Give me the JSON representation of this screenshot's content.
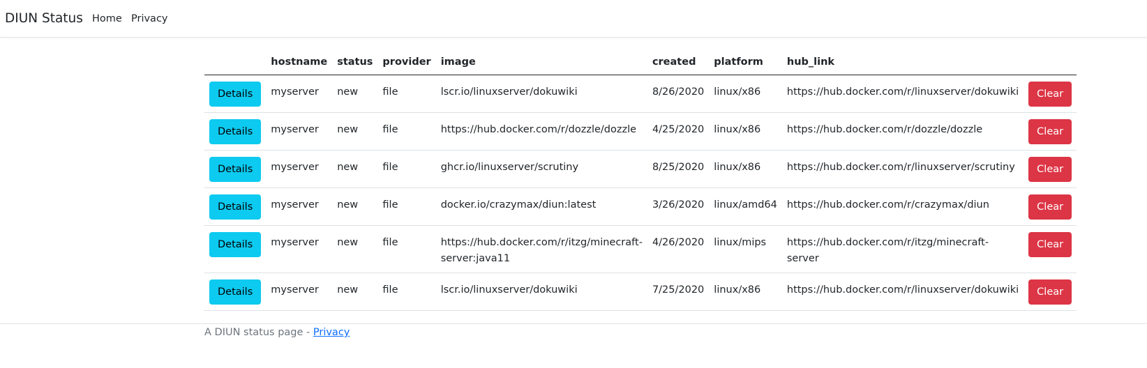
{
  "navbar": {
    "brand": "DIUN Status",
    "links": [
      "Home",
      "Privacy"
    ]
  },
  "table": {
    "headers": [
      "",
      "hostname",
      "status",
      "provider",
      "image",
      "created",
      "platform",
      "hub_link",
      ""
    ],
    "details_label": "Details",
    "clear_label": "Clear",
    "rows": [
      {
        "hostname": "myserver",
        "status": "new",
        "provider": "file",
        "image": "lscr.io/linuxserver/dokuwiki",
        "created": "8/26/2020",
        "platform": "linux/x86",
        "hub_link": "https://hub.docker.com/r/linuxserver/dokuwiki"
      },
      {
        "hostname": "myserver",
        "status": "new",
        "provider": "file",
        "image": "https://hub.docker.com/r/dozzle/dozzle",
        "created": "4/25/2020",
        "platform": "linux/x86",
        "hub_link": "https://hub.docker.com/r/dozzle/dozzle"
      },
      {
        "hostname": "myserver",
        "status": "new",
        "provider": "file",
        "image": "ghcr.io/linuxserver/scrutiny",
        "created": "8/25/2020",
        "platform": "linux/x86",
        "hub_link": "https://hub.docker.com/r/linuxserver/scrutiny"
      },
      {
        "hostname": "myserver",
        "status": "new",
        "provider": "file",
        "image": "docker.io/crazymax/diun:latest",
        "created": "3/26/2020",
        "platform": "linux/amd64",
        "hub_link": "https://hub.docker.com/r/crazymax/diun"
      },
      {
        "hostname": "myserver",
        "status": "new",
        "provider": "file",
        "image": "https://hub.docker.com/r/itzg/minecraft-server:java11",
        "created": "4/26/2020",
        "platform": "linux/mips",
        "hub_link": "https://hub.docker.com/r/itzg/minecraft-server"
      },
      {
        "hostname": "myserver",
        "status": "new",
        "provider": "file",
        "image": "lscr.io/linuxserver/dokuwiki",
        "created": "7/25/2020",
        "platform": "linux/x86",
        "hub_link": "https://hub.docker.com/r/linuxserver/dokuwiki"
      }
    ]
  },
  "footer": {
    "text": "A DIUN status page - ",
    "link": "Privacy"
  },
  "colors": {
    "details_button": "#0dcaf0",
    "clear_button": "#dc3545",
    "link": "#0d6efd"
  }
}
